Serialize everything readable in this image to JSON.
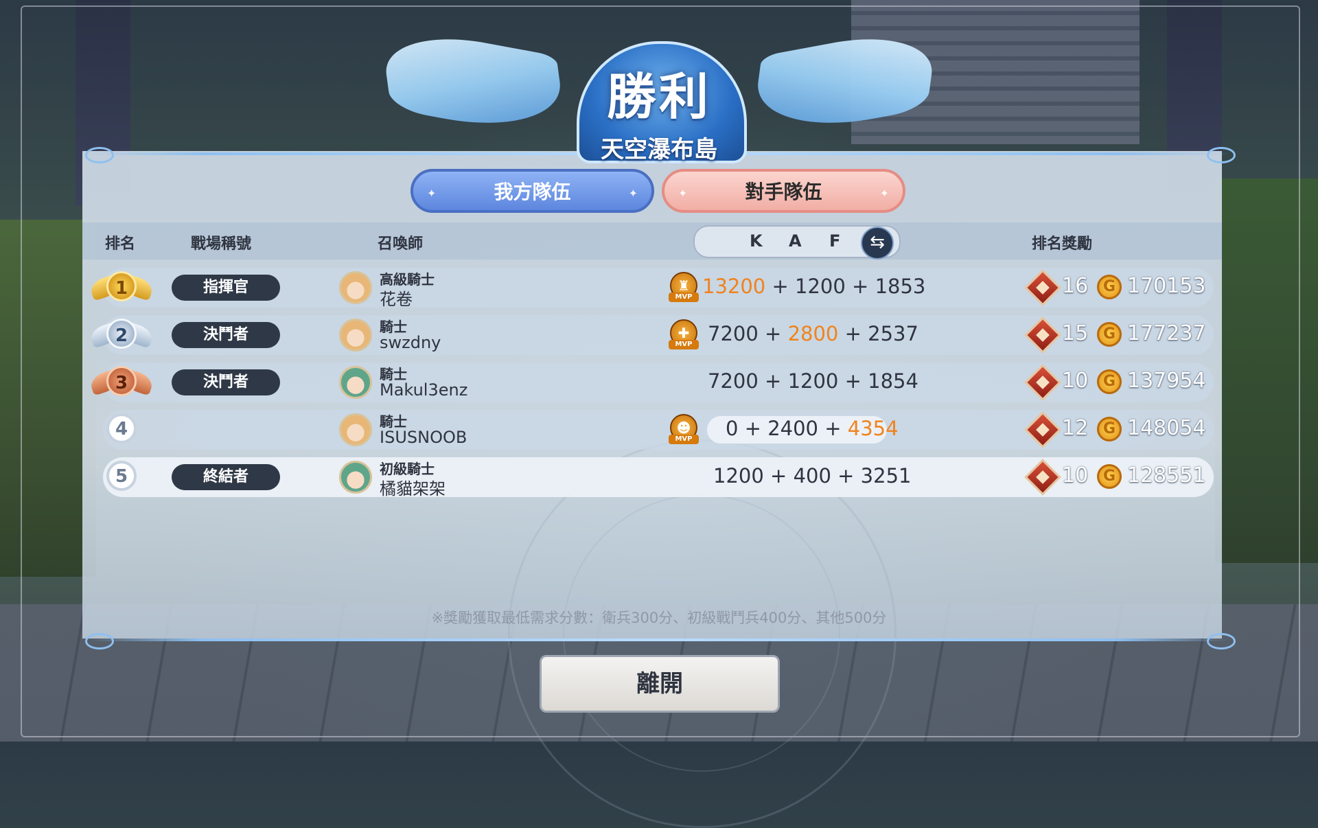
{
  "header": {
    "title": "勝利",
    "subtitle": "天空瀑布島"
  },
  "tabs": {
    "ours": "我方隊伍",
    "enemy": "對手隊伍"
  },
  "columns": {
    "rank": "排名",
    "battle_title": "戰場稱號",
    "summoner": "召喚師",
    "k": "K",
    "a": "A",
    "f": "F",
    "reward": "排名獎勵"
  },
  "rows": [
    {
      "rank": "1",
      "battle_title": "指揮官",
      "summoner_rank": "高級騎士",
      "name": "花卷",
      "k": "13200",
      "a": "1200",
      "f": "1853",
      "highlight": "k",
      "mvp": true,
      "gems": "16",
      "coins": "170153"
    },
    {
      "rank": "2",
      "battle_title": "決鬥者",
      "summoner_rank": "騎士",
      "name": "swzdny",
      "k": "7200",
      "a": "2800",
      "f": "2537",
      "highlight": "a",
      "mvp": true,
      "gems": "15",
      "coins": "177237"
    },
    {
      "rank": "3",
      "battle_title": "決鬥者",
      "summoner_rank": "騎士",
      "name": "Makul3enz",
      "k": "7200",
      "a": "1200",
      "f": "1854",
      "highlight": "",
      "mvp": false,
      "gems": "10",
      "coins": "137954"
    },
    {
      "rank": "4",
      "battle_title": "",
      "summoner_rank": "騎士",
      "name": "ISUSNOOB",
      "k": "0",
      "a": "2400",
      "f": "4354",
      "highlight": "f",
      "mvp": true,
      "gems": "12",
      "coins": "148054"
    },
    {
      "rank": "5",
      "battle_title": "終結者",
      "summoner_rank": "初級騎士",
      "name": "橘貓架架",
      "k": "1200",
      "a": "400",
      "f": "3251",
      "highlight": "",
      "mvp": false,
      "gems": "10",
      "coins": "128551"
    }
  ],
  "mvp_label": "MVP",
  "score_separator": "+",
  "footnote": "※獎勵獲取最低需求分數：衛兵300分、初級戰鬥兵400分、其他500分",
  "leave_button": "離開",
  "icons": {
    "swap": "swap-arrows-icon",
    "gem": "gem-icon",
    "coin": "coin-icon"
  },
  "colors": {
    "highlight": "#f0831c",
    "tab_ours": "#6d92e4",
    "tab_enemy": "#f3b7ae"
  }
}
